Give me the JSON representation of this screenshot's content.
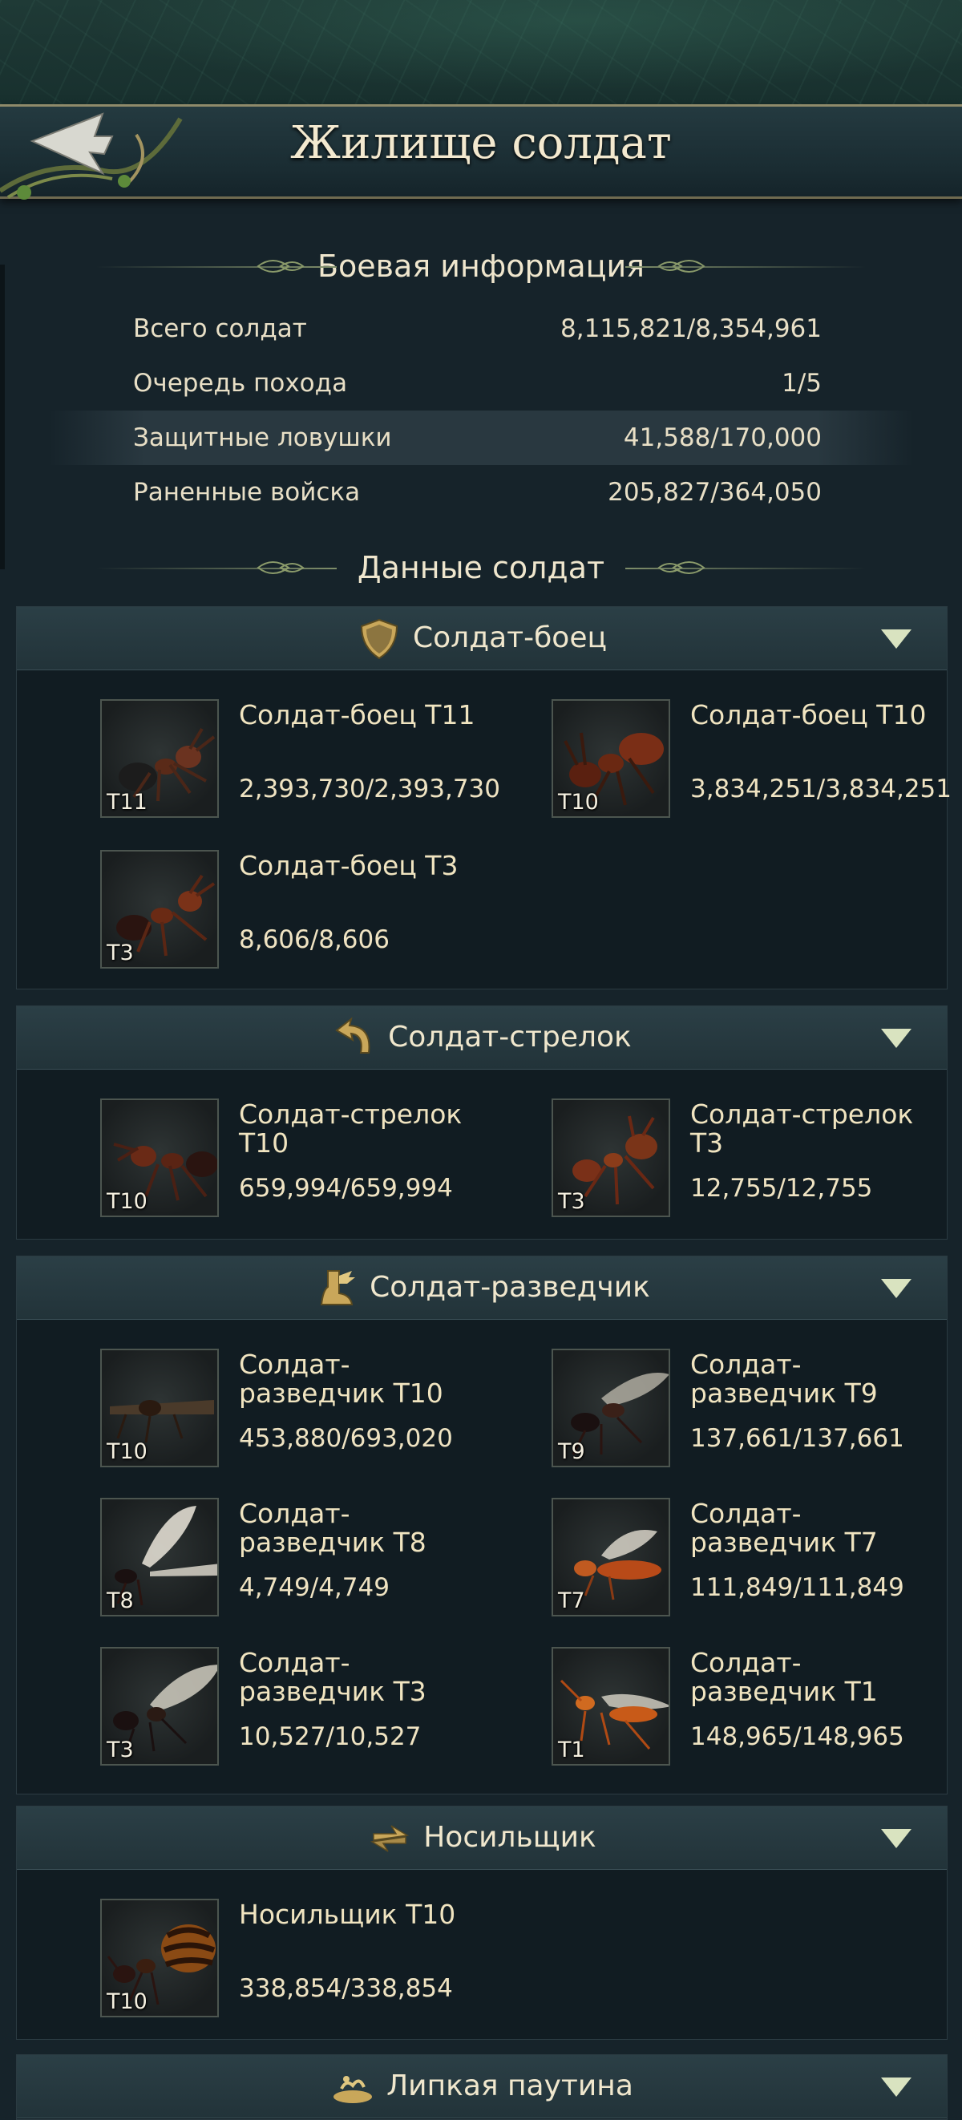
{
  "header": {
    "title": "Жилище солдат",
    "back_icon": "back-arrow-icon"
  },
  "battle_info": {
    "title": "Боевая информация",
    "rows": [
      {
        "label": "Всего солдат",
        "value": "8,115,821/8,354,961"
      },
      {
        "label": "Очередь похода",
        "value": "1/5"
      },
      {
        "label": "Защитные ловушки",
        "value": "41,588/170,000"
      },
      {
        "label": "Раненные войска",
        "value": "205,827/364,050"
      }
    ]
  },
  "soldier_data": {
    "title": "Данные солдат"
  },
  "categories": [
    {
      "name": "Солдат-боец",
      "icon": "shield-icon",
      "units": [
        {
          "name": "Солдат-боец T11",
          "count": "2,393,730/2,393,730",
          "tier": "T11"
        },
        {
          "name": "Солдат-боец T10",
          "count": "3,834,251/3,834,251",
          "tier": "T10"
        },
        {
          "name": "Солдат-боец T3",
          "count": "8,606/8,606",
          "tier": "T3"
        }
      ]
    },
    {
      "name": "Солдат-стрелок",
      "icon": "curved-arrow-icon",
      "units": [
        {
          "name": "Солдат-стрелок T10",
          "count": "659,994/659,994",
          "tier": "T10"
        },
        {
          "name": "Солдат-стрелок T3",
          "count": "12,755/12,755",
          "tier": "T3"
        }
      ]
    },
    {
      "name": "Солдат-разведчик",
      "icon": "winged-boot-icon",
      "units": [
        {
          "name": "Солдат-разведчик T10",
          "count": "453,880/693,020",
          "tier": "T10"
        },
        {
          "name": "Солдат-разведчик T9",
          "count": "137,661/137,661",
          "tier": "T9"
        },
        {
          "name": "Солдат-разведчик T8",
          "count": "4,749/4,749",
          "tier": "T8"
        },
        {
          "name": "Солдат-разведчик T7",
          "count": "111,849/111,849",
          "tier": "T7"
        },
        {
          "name": "Солдат-разведчик T3",
          "count": "10,527/10,527",
          "tier": "T3"
        },
        {
          "name": "Солдат-разведчик T1",
          "count": "148,965/148,965",
          "tier": "T1"
        }
      ]
    },
    {
      "name": "Носильщик",
      "icon": "transfer-arrows-icon",
      "units": [
        {
          "name": "Носильщик T10",
          "count": "338,854/338,854",
          "tier": "T10"
        }
      ]
    },
    {
      "name": "Липкая паутина",
      "icon": "sticky-web-icon",
      "units": []
    }
  ],
  "colors": {
    "background": "#16232a",
    "header_bg": "#223339",
    "text": "#e6dcc4",
    "accent_gold": "#c9a75a",
    "chevron": "#d9e3c0"
  }
}
